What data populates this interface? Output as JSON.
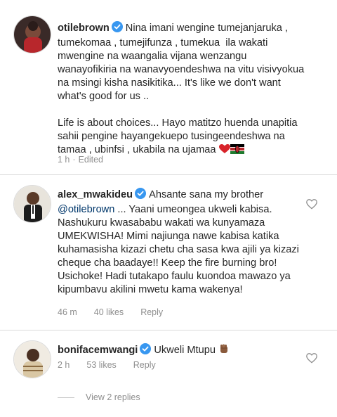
{
  "comments": [
    {
      "username": "otilebrown",
      "text": "Nina imani wengine tumejanjaruka , tumekomaa , tumejifunza , tumekua  ila wakati mwengine na waangalia vijana wenzangu wanayofikiria na wanavyoendeshwa na vitu visivyokua na msingi kisha nasikitika... It's like we don't want what's good for us ..\n\nLife is about choices... Hayo matitzo huenda unapitia sahii pengine hayangekuepo tusingeendeshwa na tamaa , ubinfsi , ukabila na ujamaa",
      "time": "1 h",
      "edited": "Edited"
    },
    {
      "username": "alex_mwakideu",
      "text_before": "Ahsante sana my brother ",
      "mention": "@otilebrown",
      "text_after": " ... Yaani umeongea ukweli kabisa. Nashukuru kwasababu wakati wa kunyamaza UMEKWISHA! Mimi najiunga nawe kabisa katika kuhamasisha kizazi chetu cha sasa kwa ajili ya kizazi cheque cha baadaye!! Keep the fire burning bro! Usichoke! Hadi tutakapo faulu kuondoa mawazo ya kipumbavu akilini mwetu kama wakenya!",
      "time": "46 m",
      "likes": "40 likes",
      "reply": "Reply"
    },
    {
      "username": "bonifacemwangi",
      "text": "Ukweli Mtupu",
      "time": "2 h",
      "likes": "53 likes",
      "reply": "Reply"
    }
  ],
  "view_replies": "View 2 replies",
  "colors": {
    "verified": "#3897f0",
    "heart_red": "#d8232a",
    "mention": "#00376b",
    "meta_gray": "#8e8e8e"
  },
  "icons": [
    "verified-badge-icon",
    "heart-outline-icon",
    "red-heart-emoji",
    "kenya-flag-emoji",
    "raised-fist-emoji"
  ]
}
